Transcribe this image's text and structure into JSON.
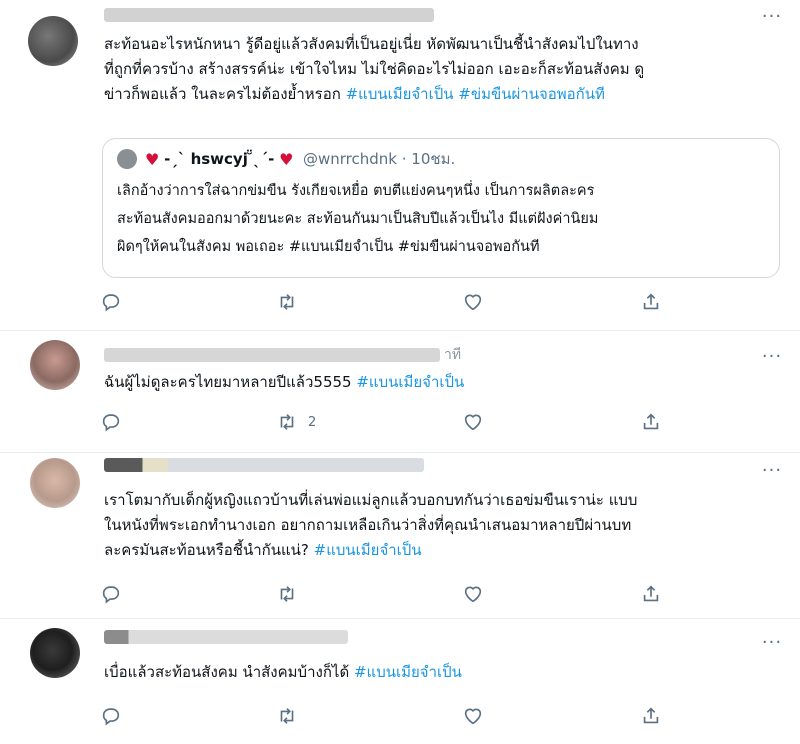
{
  "tweets": [
    {
      "lines": [
        [
          "สะท้อนอะไรหนักหนา รู้ดีอยู่แล้วสังคมที่เป็นอยู่เนี่ย หัดพัฒนาเป็นชี้นำสังคมไปในทาง"
        ],
        [
          "ที่ถูกที่ควรบ้าง สร้างสรรค์น่ะ เข้าใจไหม ไม่ใช่คิดอะไรไม่ออก เอะอะก็สะท้อนสังคม ดู"
        ],
        [
          "ข่าวก็พอแล้ว ในละครไม่ต้องย้ำหรอก "
        ]
      ],
      "tags": [
        "#แบนเมียจำเป็น",
        "#ข่มขืนผ่านจอพอกันที"
      ],
      "quote": {
        "name": "-ˏˋ hswcyj ̆̈ˎˊ-",
        "handle": "@wnrrchdnk",
        "dot": "·",
        "time": "10ชม.",
        "lines": [
          "เลิกอ้างว่าการใส่ฉากข่มขืน รังเกียจเหยื่อ ตบตีแย่งคนๆหนึ่ง เป็นการผลิตละคร",
          "สะท้อนสังคมออกมาด้วยนะคะ สะท้อนกันมาเป็นสิบปีแล้วเป็นไง มีแต่ฝังค่านิยม",
          "ผิดๆให้คนในสังคม พอเถอะ #แบนเมียจำเป็น #ข่มขืนผ่านจอพอกันที"
        ]
      }
    },
    {
      "header_tail": "าที",
      "line": "ฉันผู้ไม่ดูละครไทยมาหลายปีแล้ว5555 ",
      "tag": "#แบนเมียจำเป็น",
      "retweets": "2"
    },
    {
      "lines": [
        "เราโตมากับเด็กผู้หญิงแถวบ้านที่เล่นพ่อแม่ลูกแล้วบอกบทกันว่าเธอข่มขืนเราน่ะ แบบ",
        "ในหนังที่พระเอกทำนางเอก อยากถามเหลือเกินว่าสิ่งที่คุณนำเสนอมาหลายปีผ่านบท",
        "ละครมันสะท้อนหรือชี้นำกันแน่? "
      ],
      "tag": "#แบนเมียจำเป็น"
    },
    {
      "line": "เบื่อแล้วสะท้อนสังคม นำสังคมบ้างก็ได้ ",
      "tag": "#แบนเมียจำเป็น"
    }
  ],
  "more_glyph": "···",
  "colors": {
    "link": "#1b95e0",
    "icon": "#5b7083",
    "heart": "#d40f3a"
  }
}
